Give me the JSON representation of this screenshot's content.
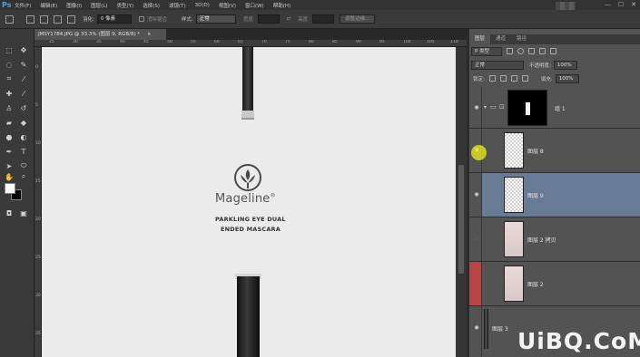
{
  "menu": {
    "logo": "Ps",
    "items": [
      "文件(F)",
      "编辑(E)",
      "图像(I)",
      "图层(L)",
      "类型(Y)",
      "选择(S)",
      "滤镜(T)",
      "3D(D)",
      "视图(V)",
      "窗口(W)",
      "帮助(H)"
    ],
    "window_controls": [
      "—",
      "☐",
      "✕"
    ]
  },
  "options": {
    "feather_label": "羽化:",
    "feather_value": "0 像素",
    "antialias_label": "消除锯齿",
    "style_label": "样式:",
    "style_value": "正常",
    "width_label": "宽度:",
    "swap": "⇄",
    "height_label": "高度:",
    "refine_button": "调整边缘..."
  },
  "document": {
    "tab_title": "JMSY1784.JPG @ 33.3% (图层 9, RGB/8) *",
    "tab_close": "×",
    "ruler_top": [
      "25",
      "30",
      "35",
      "40",
      "45",
      "50",
      "55",
      "60",
      "65",
      "70",
      "75",
      "80",
      "85",
      "90",
      "95",
      "100",
      "105",
      "110"
    ],
    "ruler_left": [
      "0",
      "5",
      "10",
      "15",
      "20",
      "25",
      "30",
      "35"
    ],
    "brand": "Mageline",
    "brand_mark": "®",
    "tagline1": "PARKLING EYE DUAL",
    "tagline2": "ENDED MASCARA"
  },
  "layers_panel": {
    "tabs": [
      "图层",
      "通道",
      "路径"
    ],
    "filter_value": "P 类型",
    "blend_mode": "正常",
    "opacity_label": "不透明度:",
    "opacity_value": "100%",
    "lock_label": "锁定:",
    "fill_label": "填充:",
    "fill_value": "100%",
    "layers": [
      {
        "name": "组 1",
        "visible": true,
        "type": "group"
      },
      {
        "name": "图层 8",
        "visible": true,
        "type": "transparent"
      },
      {
        "name": "图层 9",
        "visible": true,
        "type": "transparent",
        "selected": true
      },
      {
        "name": "图层 2 拷贝",
        "visible": false,
        "type": "photo"
      },
      {
        "name": "图层 2",
        "visible": false,
        "type": "photo",
        "highlight": "#b84545"
      },
      {
        "name": "图层 3",
        "visible": true,
        "type": "brush"
      }
    ]
  },
  "watermark": "UiBQ.CoM",
  "colors": {
    "accent_selected_layer": "#687b94",
    "red_layer_marker": "#b84545",
    "ps_blue": "#4aa3f0"
  }
}
